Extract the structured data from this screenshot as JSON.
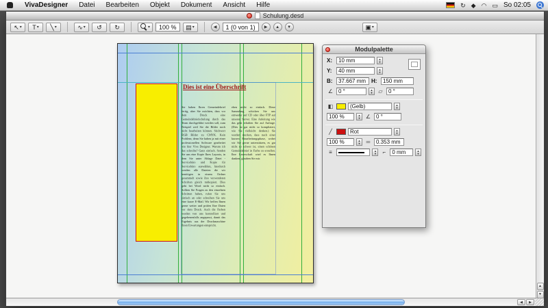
{
  "menubar": {
    "items": [
      "VivaDesigner",
      "Datei",
      "Bearbeiten",
      "Objekt",
      "Dokument",
      "Ansicht",
      "Hilfe"
    ],
    "clock": "So 02:05",
    "icons": {
      "sync": "↻",
      "bluetooth": "◆",
      "wifi": "◠",
      "battery": "▭"
    }
  },
  "window": {
    "title": "Schulung.desd",
    "toolbar": {
      "zoom_value": "100 %",
      "page_nav_value": "1 (0 von 1)",
      "tools": {
        "selection": "↖",
        "text": "T",
        "line": "╲",
        "link": "∿",
        "rotate_ccw": "↺",
        "rotate_cw": "↻",
        "prev": "◀",
        "next": "▶",
        "up": "▲",
        "down": "▼",
        "page": "▤",
        "layers": "▣",
        "caret": "▾",
        "step_up": "▲",
        "step_down": "▼"
      }
    }
  },
  "document": {
    "heading": "Dies ist eine Überschrift",
    "column1": "Sie haben Ihren Gemeindebrief fertig, aber Sie möchten, dass vor dem Druck eine Gemeindebriefschulung durch das Team durchgeführt werden soll, zum Beispiel weil Sie die Bilder noch nicht bearbeiten können. Stichwort RGB Bilder zu CMYK. Kein Problem; denn Sie haben ja mit einer professionellen Software gearbeitet wie hier Viva Designer. Warum ich das schreibe? Ganz einfach. Senden Sie uns eine Kopie Ihres Layouts, in dem Sie unter Ablage Datei - Servicebüro und Kopie für Servicebüro auswählen, hierdurch werden alle Dateien die wir benötigen in einem Ordner gesammelt sowie ihre verwendeten Schriften gleich mitkopiert. Dies geht bei Word nicht so einfach. Sollten Sie Fragen zu den einzelnen Schritten haben, rufen Sie uns einfach an oder schreiben Sie uns eine kurze E-Mail. Wir helfen Ihnen gerne weiter und prüfen Ihre Daten vor dem Druck. Auch die Farben werden von uns kontrolliert und gegebenenfalls angepasst, damit das Ergebnis aus der Druckmaschine Ihren Erwartungen entspricht.",
    "column2": "eben nicht so einfach. Diese Sammlung schicken Sie uns entweder auf CD oder über FTP auf unseren Server. Eine Anleitung wie das geht erhalten Sie auf Anfrage. (Dies ist gar nicht so kompliziert, wie Sie vielleicht denken.) Sie werden merken, dass nach einer kurzen Einarbeitungsphase, wobei wir Sie gerne unterstützen, es gar nicht so schwer ist, einen schönen Gemeindebrief in Farbe zu erstellen. Ihre Leserschaft wird es Ihnen danken, glauben Sie mir."
  },
  "palette": {
    "title": "Modulpalette",
    "x_label": "X:",
    "x_value": "10 mm",
    "y_label": "Y:",
    "y_value": "40 mm",
    "w_label": "B:",
    "w_value": "37.667 mm",
    "h_label": "H:",
    "h_value": "150 mm",
    "rotation_value": "0 °",
    "skew_value": "0 °",
    "fill_color_name": "(Gelb)",
    "fill_opacity": "100 %",
    "fill_angle": "0 °",
    "stroke_color_name": "Rot",
    "stroke_opacity": "100 %",
    "stroke_width": "0.353 mm",
    "line_end_value": "0 mm",
    "fill_color": "#f8ee00",
    "stroke_color": "#cc1111",
    "icons": {
      "angle": "∠",
      "skew": "▱",
      "fill": "◧",
      "stroke": "╱",
      "linewidth": "═",
      "linestyle": "≡",
      "lineend": "⌐"
    }
  }
}
